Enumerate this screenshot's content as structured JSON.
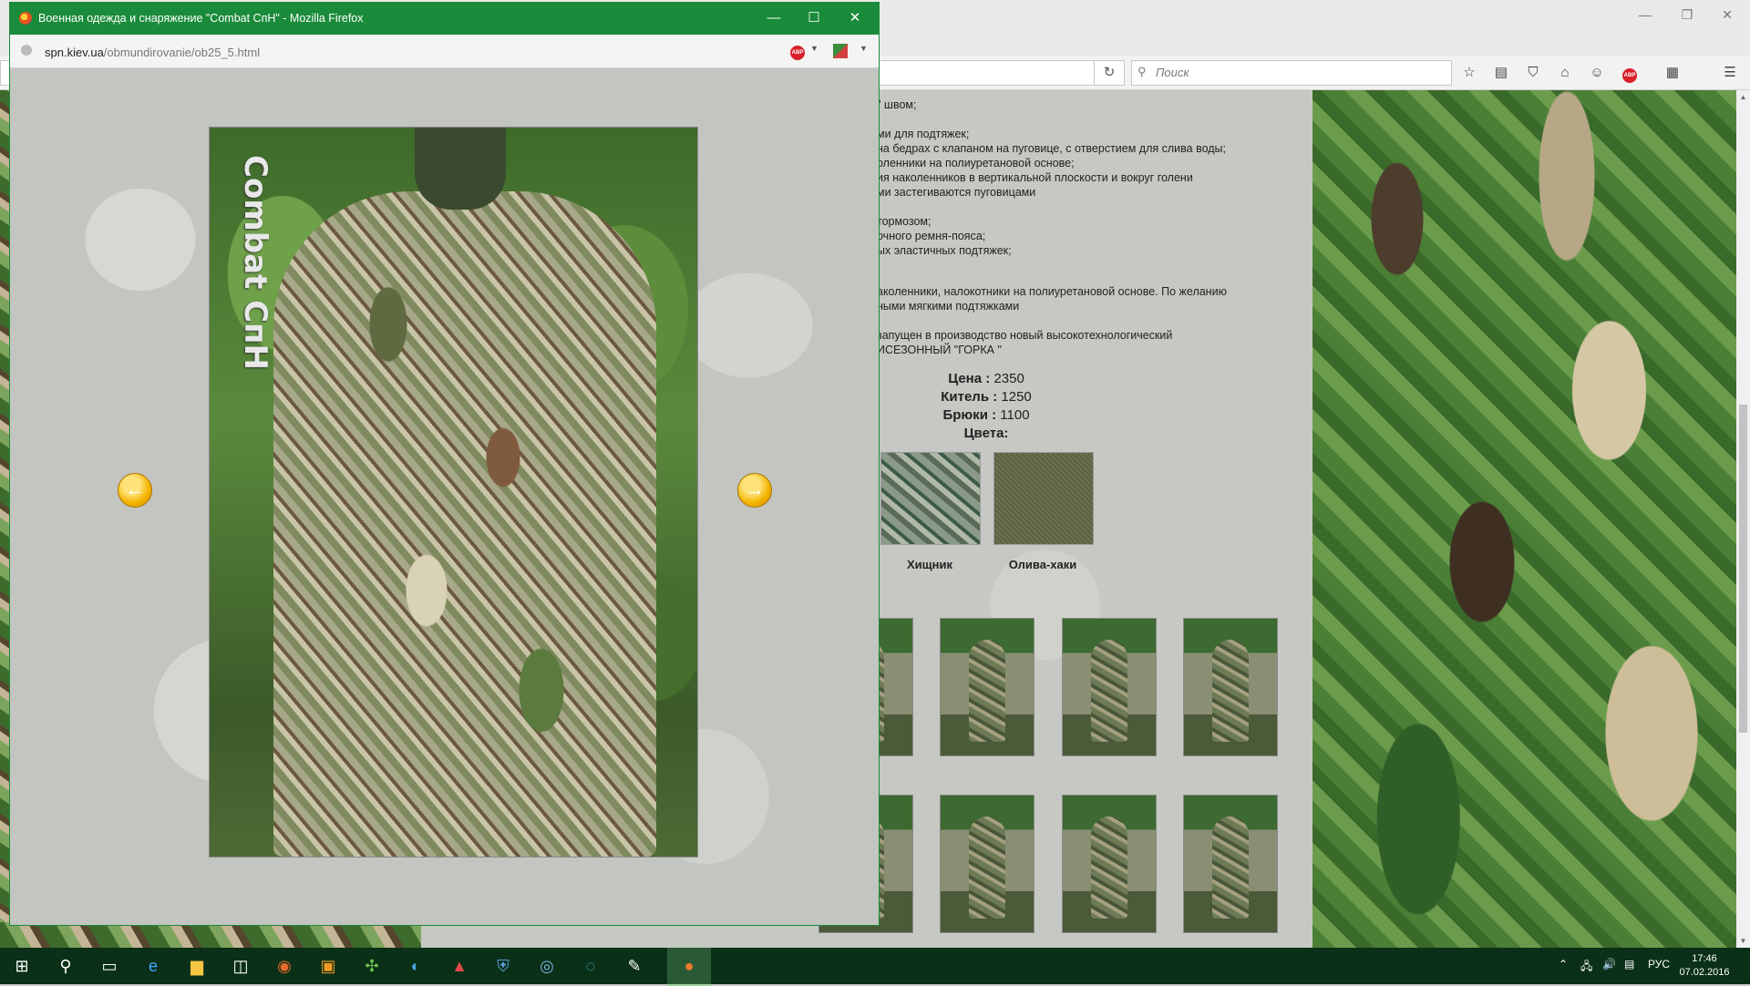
{
  "background_browser": {
    "search_placeholder": "Поиск",
    "reload_icon": "reload-icon"
  },
  "content": {
    "desc_lines": [
      "\" швом;",
      "ми для подтяжек;",
      "на бедрах с клапаном на пуговице, с отверстием для слива воды;",
      "оленники на полиуретановой основе;",
      "ия наколенников в вертикальной плоскости и вокруг голени",
      "ми застегиваются пуговицами",
      "тормозом;",
      "очного ремня-пояса;",
      "ых эластичных подтяжек;",
      "аколенники, налокотники на полиуретановой основе. По желанию",
      "ными мягкими подтяжками",
      "запущен в производство новый высокотехнологический",
      "ИСЕЗОННЫЙ \"ГОРКА \""
    ],
    "price_label": "Цена :",
    "price_value": "2350",
    "jacket_label": "Китель :",
    "jacket_value": "1250",
    "pants_label": "Брюки :",
    "pants_value": "1100",
    "colors_label": "Цвета:",
    "swatches": [
      {
        "label": "Хищник",
        "color": "#8b9a88"
      },
      {
        "label": "Олива-хаки",
        "color": "#6d7050"
      }
    ]
  },
  "popup": {
    "title": "Военная одежда и снаряжение \"Combat СпН\" - Mozilla Firefox",
    "url_domain": "spn.kiev.ua",
    "url_path": "/obmundirovanie/ob25_5.html",
    "photo_watermark": "Combat СпН",
    "prev_label": "←",
    "next_label": "→",
    "title_color": "#1a8b3a"
  },
  "taskbar": {
    "language": "РУС",
    "time": "17:46",
    "date": "07.02.2016"
  }
}
